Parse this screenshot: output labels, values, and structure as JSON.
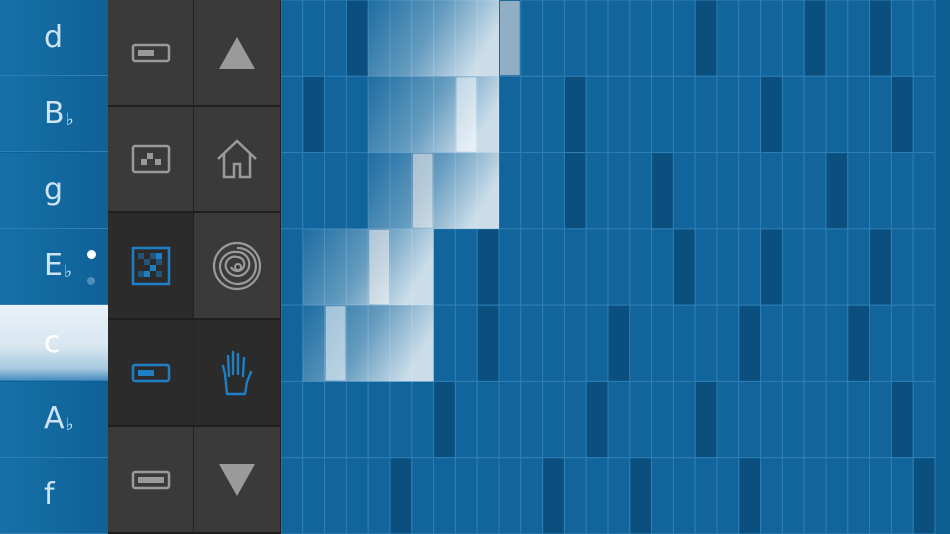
{
  "notes": [
    {
      "name": "d",
      "accidental": "",
      "active": false
    },
    {
      "name": "B",
      "accidental": "♭",
      "active": false
    },
    {
      "name": "g",
      "accidental": "",
      "active": false
    },
    {
      "name": "E",
      "accidental": "♭",
      "active": false
    },
    {
      "name": "c",
      "accidental": "",
      "active": true
    },
    {
      "name": "A",
      "accidental": "♭",
      "active": false
    },
    {
      "name": "f",
      "accidental": "",
      "active": false
    }
  ],
  "page_indicator": {
    "pages": 2,
    "current": 1
  },
  "tools": [
    {
      "id": "clip-small",
      "icon": "small-clip-icon",
      "selected": false
    },
    {
      "id": "scroll-up",
      "icon": "up-arrow-icon",
      "selected": false
    },
    {
      "id": "clip-dots",
      "icon": "dotted-clip-icon",
      "selected": false
    },
    {
      "id": "home",
      "icon": "home-icon",
      "selected": false
    },
    {
      "id": "grid-pattern",
      "icon": "grid-pattern-icon",
      "selected": true
    },
    {
      "id": "spiral",
      "icon": "spiral-icon",
      "selected": false
    },
    {
      "id": "clip-selected",
      "icon": "selected-clip-icon",
      "selected": true
    },
    {
      "id": "hand",
      "icon": "hand-icon",
      "selected": true
    },
    {
      "id": "clip-bar",
      "icon": "bar-clip-icon",
      "selected": false
    },
    {
      "id": "scroll-down",
      "icon": "down-arrow-icon",
      "selected": false
    }
  ],
  "colors": {
    "grid_base": "#11659c",
    "grid_accent": "#0a4f7e",
    "grid_line": "#2f7fb5",
    "icon_idle": "#9a9a9a",
    "icon_active": "#1e7fc4",
    "highlight": "#ffffff"
  },
  "grid": {
    "columns": 30,
    "rows": 7,
    "dark_cells": [
      [
        3,
        0
      ],
      [
        10,
        0
      ],
      [
        19,
        0
      ],
      [
        24,
        0
      ],
      [
        27,
        0
      ],
      [
        1,
        1
      ],
      [
        13,
        1
      ],
      [
        22,
        1
      ],
      [
        28,
        1
      ],
      [
        6,
        2
      ],
      [
        13,
        2
      ],
      [
        17,
        2
      ],
      [
        25,
        2
      ],
      [
        4,
        3
      ],
      [
        9,
        3
      ],
      [
        18,
        3
      ],
      [
        22,
        3
      ],
      [
        27,
        3
      ],
      [
        9,
        4
      ],
      [
        15,
        4
      ],
      [
        21,
        4
      ],
      [
        26,
        4
      ],
      [
        7,
        5
      ],
      [
        14,
        5
      ],
      [
        19,
        5
      ],
      [
        28,
        5
      ],
      [
        5,
        6
      ],
      [
        12,
        6
      ],
      [
        16,
        6
      ],
      [
        21,
        6
      ],
      [
        29,
        6
      ]
    ],
    "lit_regions": [
      {
        "row": 0,
        "start": 4,
        "end": 10
      },
      {
        "row": 1,
        "start": 4,
        "end": 10
      },
      {
        "row": 2,
        "start": 4,
        "end": 10
      },
      {
        "row": 3,
        "start": 1,
        "end": 7
      },
      {
        "row": 4,
        "start": 1,
        "end": 7
      }
    ],
    "bright_cells": [
      [
        10,
        0
      ],
      [
        8,
        1
      ],
      [
        6,
        2
      ],
      [
        4,
        3
      ],
      [
        2,
        4
      ]
    ]
  }
}
